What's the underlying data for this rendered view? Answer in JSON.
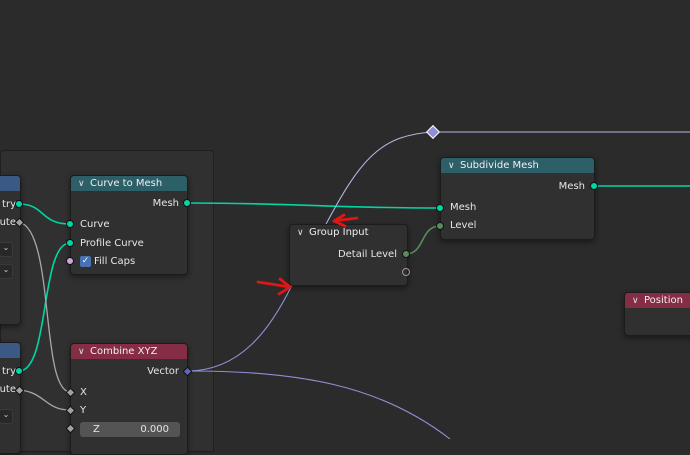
{
  "nodes": {
    "curve_to_mesh": {
      "title": "Curve to Mesh",
      "output_mesh": "Mesh",
      "input_curve": "Curve",
      "input_profile_curve": "Profile Curve",
      "fill_caps": "Fill Caps",
      "fill_caps_checked": "✓"
    },
    "combine_xyz": {
      "title": "Combine XYZ",
      "output_vector": "Vector",
      "input_x": "X",
      "input_y": "Y",
      "input_z_label": "Z",
      "input_z_value": "0.000"
    },
    "group_input": {
      "title": "Group Input",
      "output_detail_level": "Detail Level"
    },
    "subdivide_mesh": {
      "title": "Subdivide Mesh",
      "output_mesh": "Mesh",
      "input_mesh": "Mesh",
      "input_level": "Level"
    },
    "position": {
      "title": "Position"
    },
    "cut_node_top": {
      "label_a": "try",
      "label_b": "ute"
    },
    "cut_node_bottom": {
      "label_a": "try",
      "label_b": "ute"
    }
  },
  "colors": {
    "background": "#2b2b2b",
    "geometry_wire": "#00d6a3",
    "vector_wire": "#8f8fd6",
    "annotation_arrow": "#e01515"
  }
}
